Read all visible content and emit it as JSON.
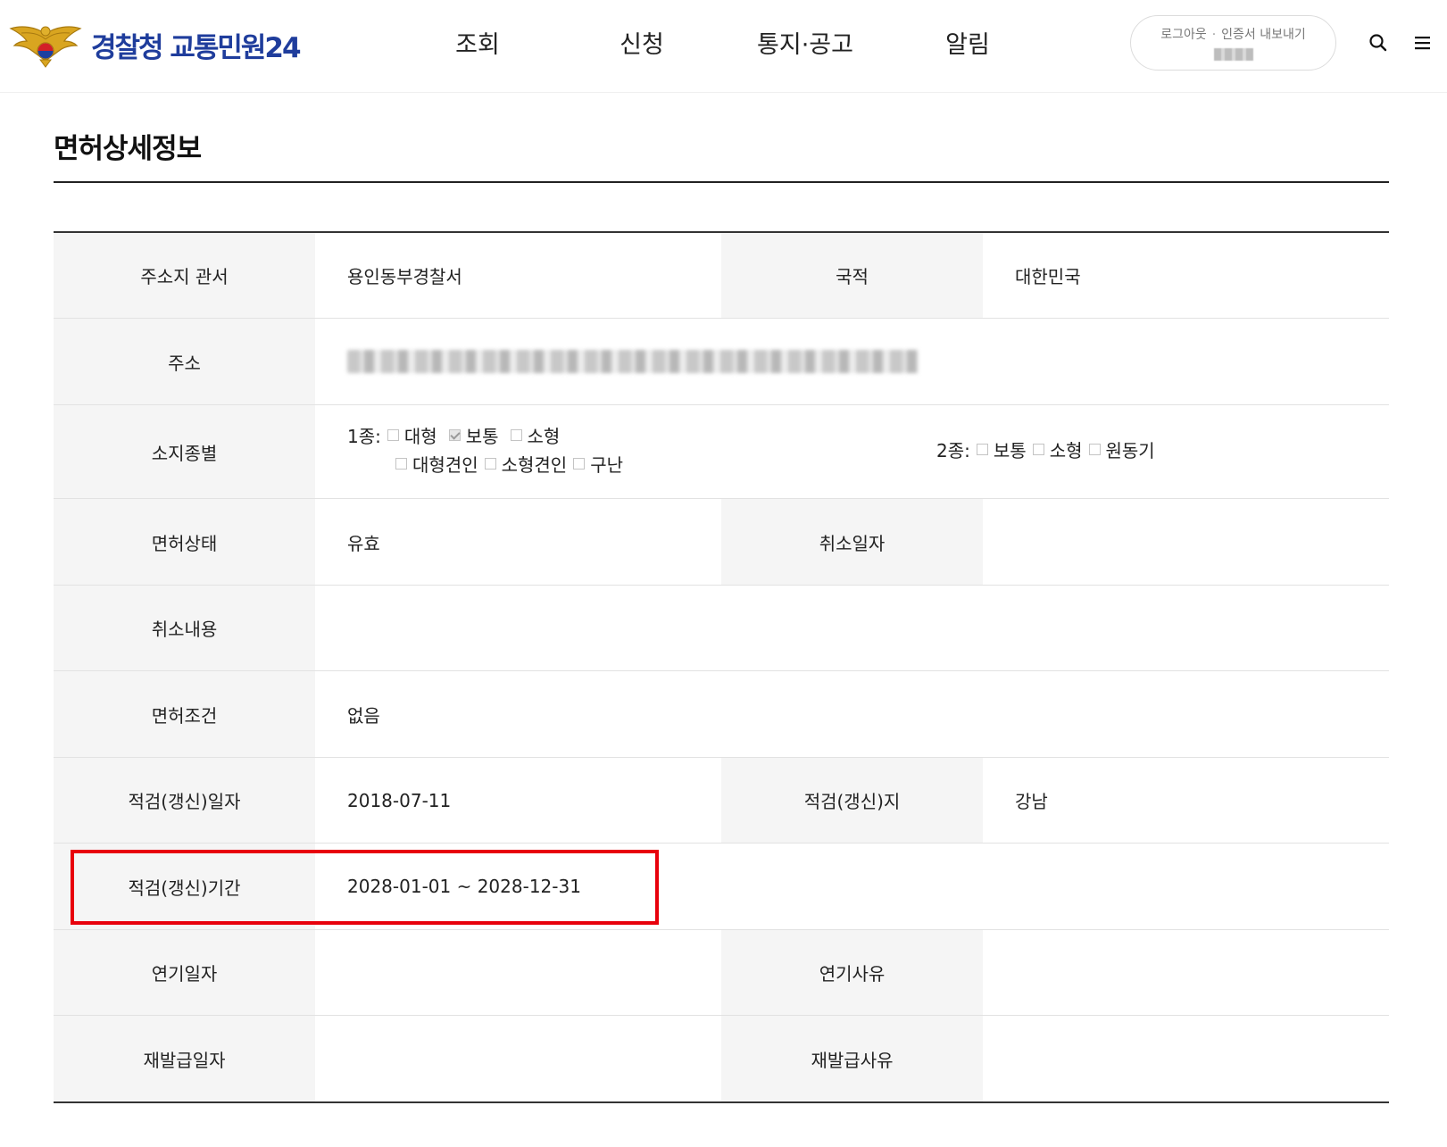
{
  "header": {
    "logo_text": "경찰청 교통민원24",
    "nav": [
      "조회",
      "신청",
      "통지·공고",
      "알림"
    ],
    "util": {
      "logout": "로그아웃",
      "sep": "·",
      "cert_export": "인증서 내보내기"
    },
    "colors": {
      "brand": "#1f3d9c",
      "highlight": "#e8000b"
    },
    "icons": [
      "police-emblem-icon",
      "search-icon",
      "menu-icon"
    ]
  },
  "page": {
    "title": "면허상세정보"
  },
  "detail": {
    "jurisdiction": {
      "label": "주소지 관서",
      "value": "용인동부경찰서"
    },
    "nationality": {
      "label": "국적",
      "value": "대한민국"
    },
    "address": {
      "label": "주소"
    },
    "license_type": {
      "label": "소지종별",
      "class1_label": "1종:",
      "class1": [
        {
          "name": "대형",
          "checked": false
        },
        {
          "name": "보통",
          "checked": true
        },
        {
          "name": "소형",
          "checked": false
        },
        {
          "name": "대형견인",
          "checked": false
        },
        {
          "name": "소형견인",
          "checked": false
        },
        {
          "name": "구난",
          "checked": false
        }
      ],
      "class2_label": "2종:",
      "class2": [
        {
          "name": "보통",
          "checked": false
        },
        {
          "name": "소형",
          "checked": false
        },
        {
          "name": "원동기",
          "checked": false
        }
      ]
    },
    "status": {
      "label": "면허상태",
      "value": "유효"
    },
    "cancel_date": {
      "label": "취소일자",
      "value": ""
    },
    "cancel_detail": {
      "label": "취소내용",
      "value": ""
    },
    "condition": {
      "label": "면허조건",
      "value": "없음"
    },
    "renewal_date": {
      "label": "적검(갱신)일자",
      "value": "2018-07-11"
    },
    "renewal_place": {
      "label": "적검(갱신)지",
      "value": "강남"
    },
    "renewal_period": {
      "label": "적검(갱신)기간",
      "value": "2028-01-01 ~ 2028-12-31"
    },
    "postpone_date": {
      "label": "연기일자",
      "value": ""
    },
    "postpone_reason": {
      "label": "연기사유",
      "value": ""
    },
    "reissue_date": {
      "label": "재발급일자",
      "value": ""
    },
    "reissue_reason": {
      "label": "재발급사유",
      "value": ""
    }
  }
}
